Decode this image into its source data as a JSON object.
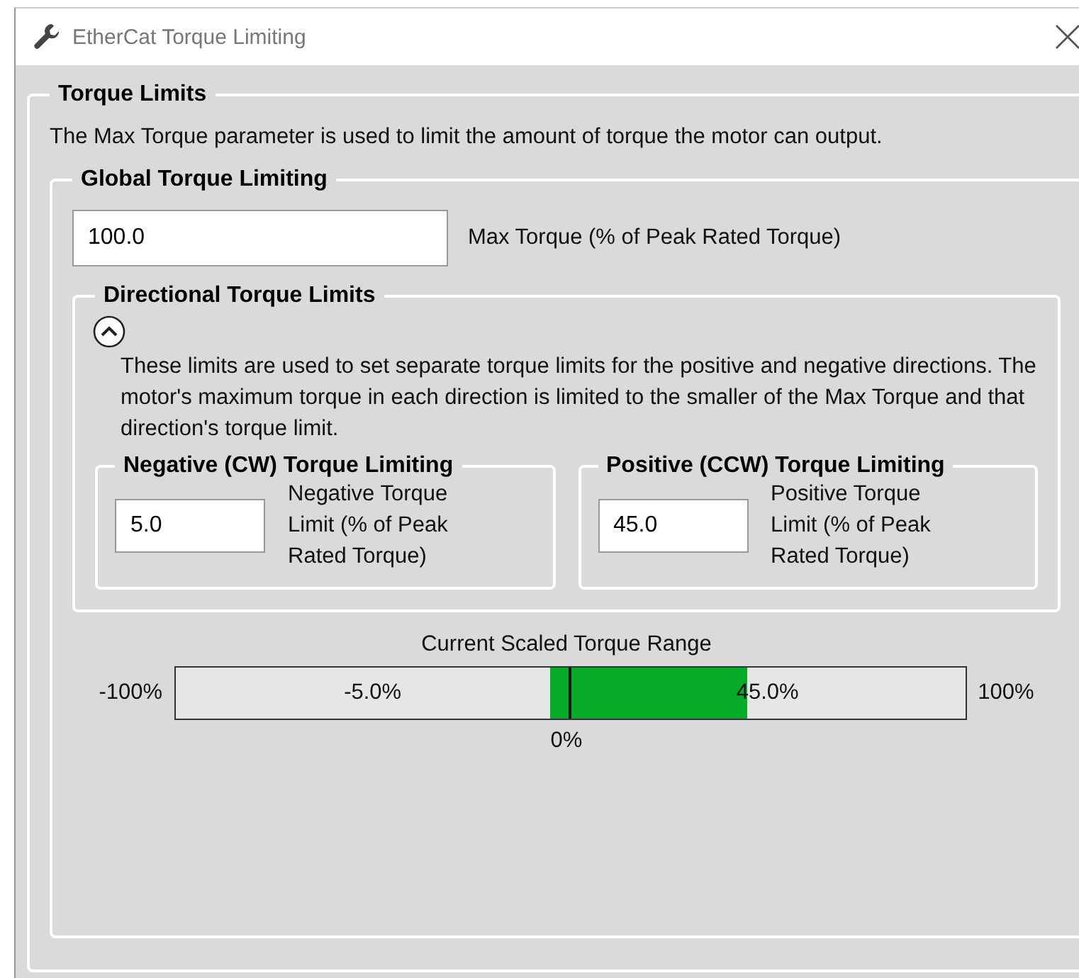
{
  "window": {
    "title": "EtherCat Torque Limiting"
  },
  "torque_limits": {
    "title": "Torque Limits",
    "description": "The Max Torque parameter is used to limit the amount of torque the motor can output.",
    "global": {
      "title": "Global Torque Limiting",
      "max_torque": {
        "value": "100.0",
        "label": "Max Torque (% of Peak Rated Torque)"
      },
      "directional": {
        "title": "Directional Torque Limits",
        "expanded": true,
        "description": "These limits are used to set separate torque limits for the positive and negative directions. The motor's maximum torque in each direction is limited to the smaller of the Max Torque and that direction's torque limit.",
        "groups": [
          {
            "title": "Negative (CW) Torque Limiting",
            "value": "5.0",
            "caption": "Negative Torque Limit (% of Peak Rated Torque)"
          },
          {
            "title": "Positive (CCW) Torque Limiting",
            "value": "45.0",
            "caption": "Positive Torque Limit (% of Peak Rated Torque)"
          }
        ]
      },
      "range": {
        "title": "Current Scaled Torque Range",
        "min_label": "-100%",
        "max_label": "100%",
        "zero_label": "0%",
        "negative": {
          "label": "-5.0%",
          "level": 0.05
        },
        "positive": {
          "label": "45.0%",
          "level": 0.45
        }
      }
    }
  }
}
